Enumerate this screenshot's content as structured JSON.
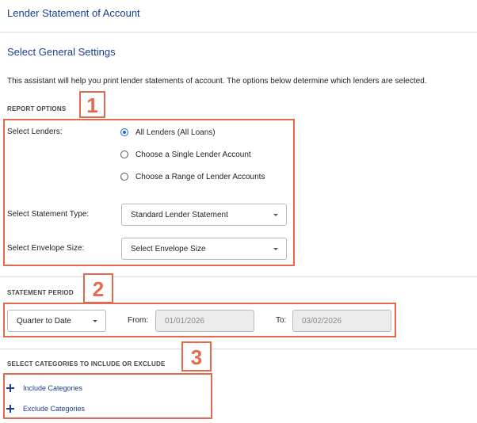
{
  "page": {
    "title": "Lender Statement of Account",
    "section_title": "Select General Settings",
    "intro": "This assistant will help you print lender statements of account. The options below determine which lenders are selected."
  },
  "report_options": {
    "heading": "REPORT OPTIONS",
    "badge": "1",
    "select_lenders_label": "Select Lenders:",
    "lender_options": [
      {
        "label": "All Lenders (All Loans)",
        "selected": true
      },
      {
        "label": "Choose a Single Lender Account",
        "selected": false
      },
      {
        "label": "Choose a Range of Lender Accounts",
        "selected": false
      }
    ],
    "statement_type_label": "Select Statement Type:",
    "statement_type_value": "Standard Lender Statement",
    "envelope_size_label": "Select Envelope Size:",
    "envelope_size_value": "Select Envelope Size"
  },
  "statement_period": {
    "heading": "STATEMENT PERIOD",
    "badge": "2",
    "period_value": "Quarter to Date",
    "from_label": "From:",
    "from_value": "01/01/2026",
    "to_label": "To:",
    "to_value": "03/02/2026"
  },
  "categories": {
    "heading": "SELECT CATEGORIES TO INCLUDE OR EXCLUDE",
    "badge": "3",
    "include_label": "Include Categories",
    "exclude_label": "Exclude Categories"
  },
  "colors": {
    "accent_blue": "#1a3d8f",
    "radio_blue": "#1a66d6",
    "annotation": "#e26a4f"
  }
}
